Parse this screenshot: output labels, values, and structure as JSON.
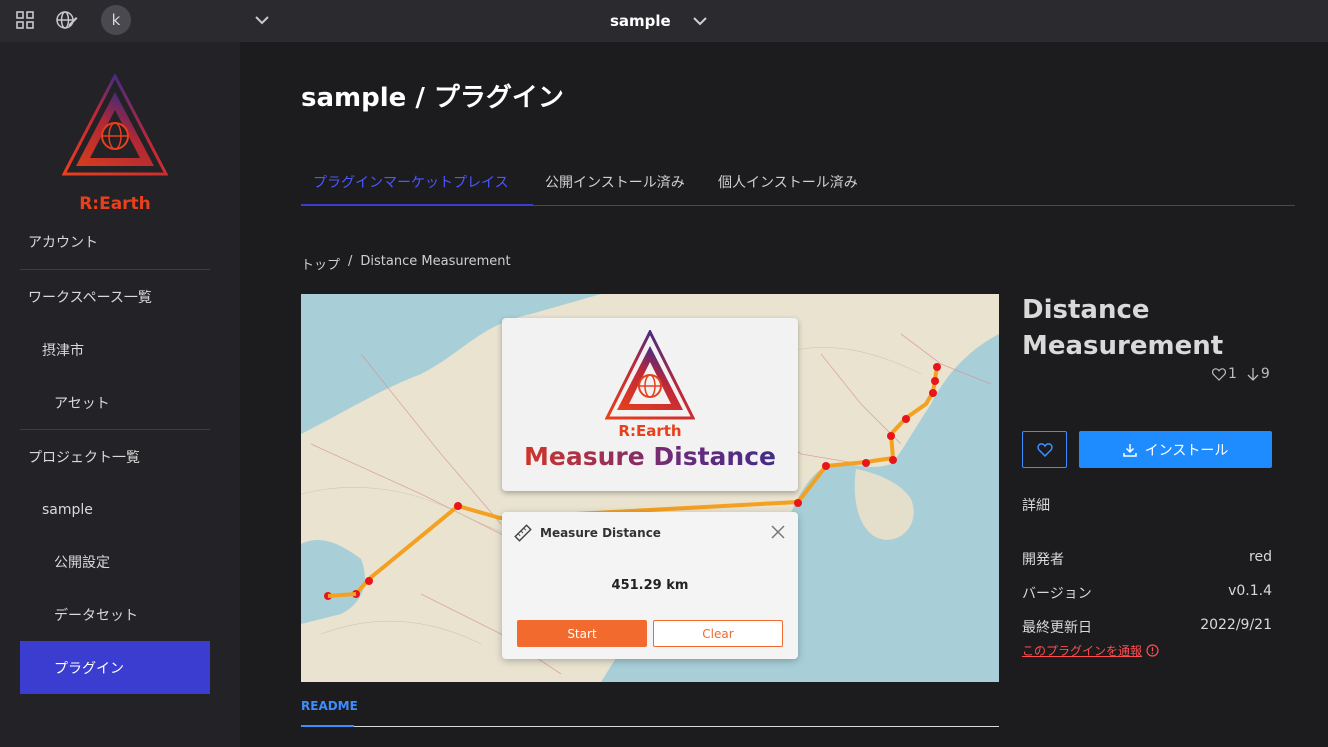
{
  "topbar": {
    "avatar_letter": "k",
    "workspace_name": "sample"
  },
  "sidebar": {
    "logo_text": "R:Earth",
    "items": [
      {
        "label": "アカウント"
      },
      {
        "label": "ワークスペース一覧"
      },
      {
        "label": "摂津市"
      },
      {
        "label": "アセット"
      },
      {
        "label": "プロジェクト一覧"
      },
      {
        "label": "sample"
      },
      {
        "label": "公開設定"
      },
      {
        "label": "データセット"
      },
      {
        "label": "プラグイン"
      }
    ]
  },
  "main": {
    "title": "sample / プラグイン",
    "tabs": [
      {
        "label": "プラグインマーケットプレイス"
      },
      {
        "label": "公開インストール済み"
      },
      {
        "label": "個人インストール済み"
      }
    ],
    "breadcrumb": {
      "home": "トップ",
      "separator": "/",
      "current": "Distance Measurement"
    },
    "hero": {
      "logo_text": "R:Earth",
      "card_title": "Measure Distance",
      "dialog_title": "Measure Distance",
      "distance": "451.29 km",
      "start_label": "Start",
      "clear_label": "Clear"
    },
    "readme_tab": "README"
  },
  "plugin": {
    "name": "Distance Measurement",
    "likes": "1",
    "downloads": "9",
    "install_label": "インストール",
    "details_label": "詳細",
    "info": [
      {
        "key": "開発者",
        "value": "red"
      },
      {
        "key": "バージョン",
        "value": "v0.1.4"
      },
      {
        "key": "最終更新日",
        "value": "2022/9/21"
      }
    ],
    "report_label": "このプラグインを通報"
  },
  "colors": {
    "accent": "#3b3cd0",
    "install": "#1e8cff",
    "orange": "#f26a2e",
    "danger": "#ff4d4f"
  }
}
